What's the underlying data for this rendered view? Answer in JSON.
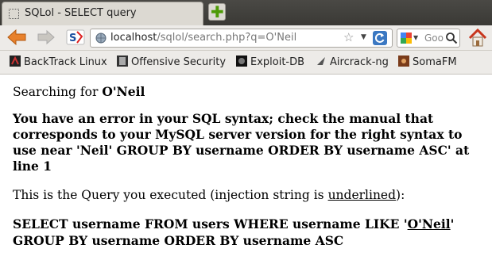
{
  "tab": {
    "title": "SQLol - SELECT query"
  },
  "toolbar": {
    "url_host": "localhost",
    "url_path": "/sqlol/search.php?q=O'Neil",
    "search_placeholder": "Goo"
  },
  "bookmarks": [
    {
      "label": "BackTrack Linux"
    },
    {
      "label": "Offensive Security"
    },
    {
      "label": "Exploit-DB"
    },
    {
      "label": "Aircrack-ng"
    },
    {
      "label": "SomaFM"
    }
  ],
  "content": {
    "search_prefix": "Searching for ",
    "search_term": "O'Neil",
    "error": "You have an error in your SQL syntax; check the manual that corresponds to your MySQL server version for the right syntax to use near 'Neil' GROUP BY username ORDER BY username ASC' at line 1",
    "query_intro_prefix": "This is the Query you executed (injection string is ",
    "query_intro_underlined": "underlined",
    "query_intro_suffix": "):",
    "query_prefix": "SELECT username FROM users WHERE username LIKE '",
    "query_injection": "O'Neil",
    "query_suffix": "' GROUP BY username ORDER BY username ASC"
  }
}
